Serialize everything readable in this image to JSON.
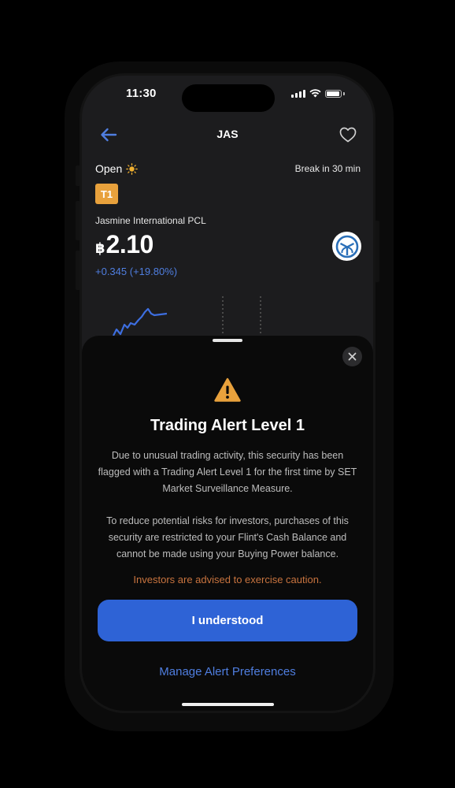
{
  "status_bar": {
    "time": "11:30"
  },
  "header": {
    "symbol": "JAS"
  },
  "market": {
    "status": "Open",
    "break_text": "Break in 30 min"
  },
  "stock": {
    "badge": "T1",
    "company_name": "Jasmine International PCL",
    "currency_symbol": "฿",
    "price": "2.10",
    "change": "+0.345 (+19.80%)"
  },
  "alert": {
    "title": "Trading Alert Level 1",
    "paragraph_1": "Due to unusual trading activity, this security has been flagged with a Trading Alert Level 1 for the first time by SET Market Surveillance Measure.",
    "paragraph_2": "To reduce potential risks for investors, purchases of this security are restricted to your Flint's Cash Balance and cannot be made using your Buying Power balance.",
    "caution": "Investors are advised to exercise caution.",
    "primary_button": "I understood",
    "link_button": "Manage Alert Preferences"
  },
  "colors": {
    "accent": "#2e63d6",
    "link": "#4f7ee0",
    "warning": "#e8a13c",
    "caution_text": "#c8743f"
  },
  "icons": [
    "back-arrow-icon",
    "heart-icon",
    "sun-icon",
    "company-logo-icon",
    "close-icon",
    "warning-icon"
  ]
}
